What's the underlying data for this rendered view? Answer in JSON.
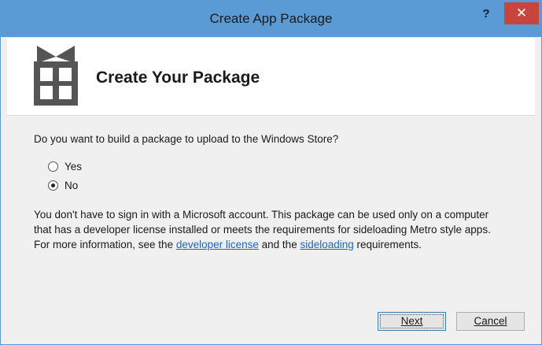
{
  "window": {
    "title": "Create App Package",
    "help_label": "?",
    "close_label": "✕"
  },
  "header": {
    "title": "Create Your Package",
    "icon": "gift-package-icon"
  },
  "body": {
    "question": "Do you want to build a package to upload to the Windows Store?",
    "options": [
      {
        "label": "Yes",
        "selected": false
      },
      {
        "label": "No",
        "selected": true
      }
    ],
    "info_line1": "You don't have to sign in with a Microsoft account. This package can be used only on a computer",
    "info_line2": "that has a developer license installed or meets the requirements for sideloading Metro style apps.",
    "info_line3_pre": "For more information, see the ",
    "link_developer_license": "developer license",
    "info_line3_mid": " and the ",
    "link_sideloading": "sideloading",
    "info_line3_post": " requirements."
  },
  "footer": {
    "next_label": "Next",
    "cancel_label": "Cancel"
  },
  "colors": {
    "titlebar": "#5b9bd5",
    "close": "#c7453c",
    "link": "#1a66c9",
    "icon": "#555555"
  }
}
